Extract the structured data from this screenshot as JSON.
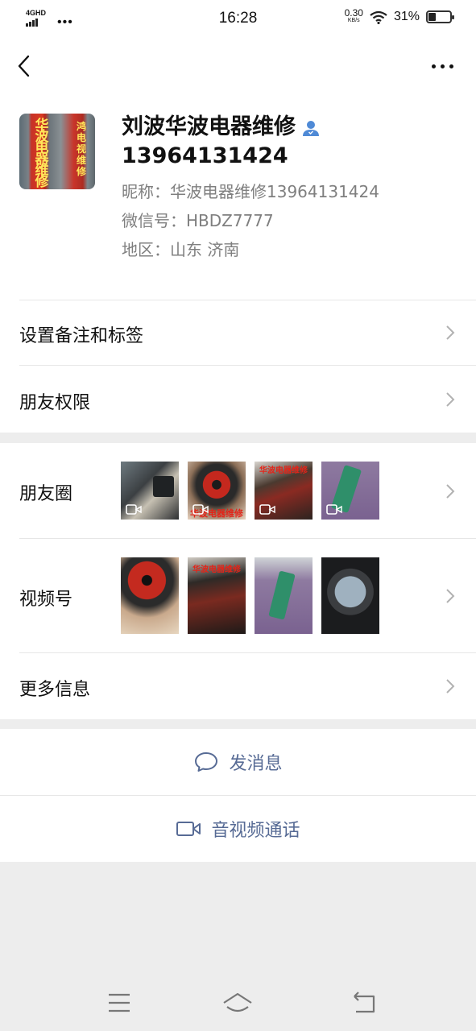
{
  "status_bar": {
    "network": "4GHD",
    "time": "16:28",
    "speed_value": "0.30",
    "speed_unit": "KB/s",
    "battery_percent": "31%",
    "battery_level": 0.31
  },
  "profile": {
    "avatar_text_left": [
      "华",
      "波",
      "电",
      "器",
      "维",
      "修"
    ],
    "avatar_text_right": [
      "鸿",
      "电",
      "视",
      "维",
      "修"
    ],
    "name_line1": "刘波华波电器维修",
    "name_line2": "13964131424",
    "nickname": "昵称：华波电器维修13964131424",
    "wechat_id": "微信号：HBDZ7777",
    "region": "地区：山东  济南"
  },
  "rows": {
    "remark_tags": "设置备注和标签",
    "friend_permissions": "朋友权限",
    "moments": "朋友圈",
    "channels": "视频号",
    "more_info": "更多信息"
  },
  "moments_thumbs": [
    {
      "caption": ""
    },
    {
      "caption": "华波电器维修"
    },
    {
      "caption": "华波电器维修"
    },
    {
      "caption": ""
    }
  ],
  "channels_thumbs": [
    {
      "caption": ""
    },
    {
      "caption": "华波电器维修"
    },
    {
      "caption": ""
    },
    {
      "caption": ""
    }
  ],
  "actions": {
    "send_message": "发消息",
    "av_call": "音视频通话"
  },
  "colors": {
    "link": "#576b95",
    "background": "#ededed",
    "verified": "#4f8ad6"
  }
}
